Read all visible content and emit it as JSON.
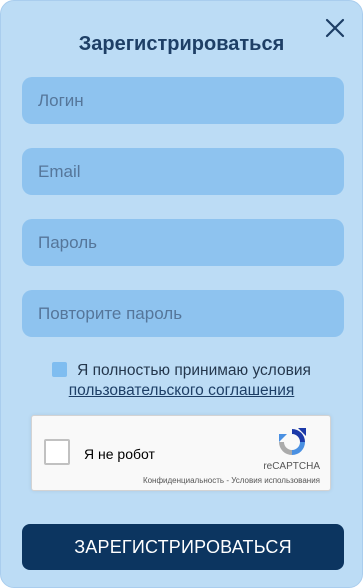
{
  "modal": {
    "title": "Зарегистрироваться"
  },
  "fields": {
    "login": {
      "value": "",
      "placeholder": "Логин"
    },
    "email": {
      "value": "",
      "placeholder": "Email"
    },
    "password": {
      "value": "",
      "placeholder": "Пароль"
    },
    "password_repeat": {
      "value": "",
      "placeholder": "Повторите пароль"
    }
  },
  "agreement": {
    "checked": false,
    "text": "Я полностью принимаю условия",
    "link_text": "пользовательского соглашения"
  },
  "recaptcha": {
    "label": "Я не робот",
    "brand": "reCAPTCHA",
    "privacy": "Конфиденциальность",
    "separator": " - ",
    "terms": "Условия использования"
  },
  "submit": {
    "label": "ЗАРЕГИСТРИРОВАТЬСЯ"
  },
  "icons": {
    "close": "close-icon",
    "recaptcha_logo": "recaptcha-logo-icon"
  },
  "colors": {
    "background": "#bcdcf5",
    "field": "#8ec3ef",
    "primary": "#0c3560",
    "title": "#1e3f66"
  }
}
